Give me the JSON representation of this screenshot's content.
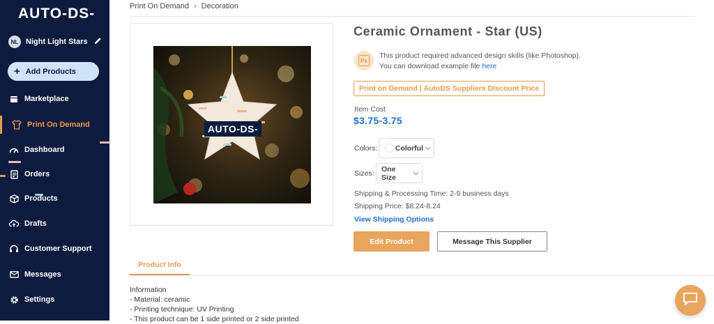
{
  "app": {
    "logo": "AUTO-DS-",
    "store": {
      "initials": "NL",
      "name": "Night Light Stars"
    },
    "add_products_label": "Add Products"
  },
  "sidebar": {
    "items": [
      {
        "label": "Marketplace",
        "icon": "store-icon",
        "active": false
      },
      {
        "label": "Print On Demand",
        "icon": "shirt-icon",
        "active": true
      },
      {
        "label": "Dashboard",
        "icon": "gauge-icon",
        "active": false
      },
      {
        "label": "Orders",
        "icon": "orders-icon",
        "active": false
      },
      {
        "label": "Products",
        "icon": "box-icon",
        "active": false
      },
      {
        "label": "Drafts",
        "icon": "cloud-upload-icon",
        "active": false
      },
      {
        "label": "Customer Support",
        "icon": "headset-icon",
        "active": false
      },
      {
        "label": "Messages",
        "icon": "mail-icon",
        "active": false
      },
      {
        "label": "Settings",
        "icon": "gear-icon",
        "active": false
      }
    ]
  },
  "breadcrumb": [
    "Print On Demand",
    "Decoration"
  ],
  "product": {
    "title": "Ceramic Ornament - Star (US)",
    "image_logo_text": "AUTO-DS-",
    "notice_line1": "This product required advanced design skills (like Photoshop).",
    "notice_line2_prefix": "You can download example file ",
    "notice_link": "here",
    "ps_icon_text": "Ps",
    "badge": "Print on Demand | AutoDS Suppliers Discount Price",
    "item_cost_label": "Item Cost",
    "item_cost": "$3.75-3.75",
    "colors_label": "Colors:",
    "color_value": "Colorful",
    "sizes_label": "Sizes:",
    "size_value": "One Size",
    "shipping_time": "Shipping & Processing Time: 2-9 business days",
    "shipping_price": "Shipping Price: $8.24-8.24",
    "view_shipping": "View Shipping Options",
    "edit_button": "Edit Product",
    "message_button": "Message This Supplier"
  },
  "tabs": [
    {
      "label": "Product Info",
      "active": true
    }
  ],
  "info": {
    "heading": "Information",
    "lines": [
      "- Material: ceramic",
      "- Printing technique: UV Printing",
      "- This product can be 1 side printed or 2 side printed"
    ]
  },
  "colors": {
    "sidebar_bg": "#0d1b3e",
    "accent": "#e89b4c",
    "link": "#1d6fd1",
    "add_button_bg": "#cfe3fb"
  }
}
